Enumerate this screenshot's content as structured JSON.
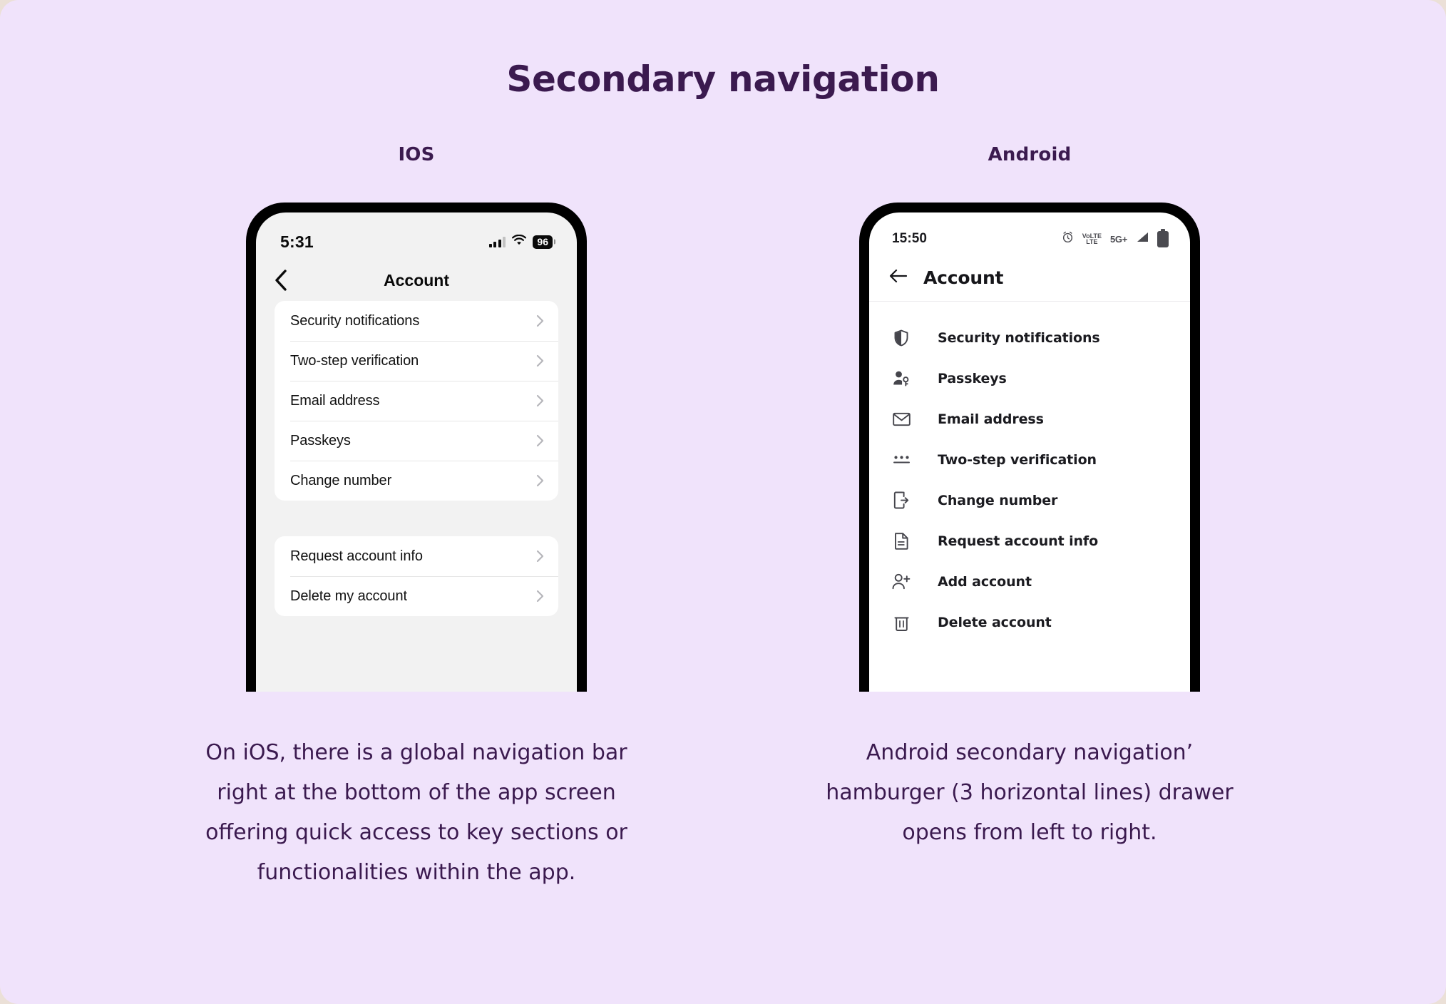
{
  "page": {
    "title": "Secondary navigation",
    "background_color": "#f0e3fb",
    "accent_color": "#3b1a4f",
    "outer_color": "#ebe0d7"
  },
  "ios": {
    "platform_label": "IOS",
    "status": {
      "time": "5:31",
      "battery_level": "96",
      "signal_icon": "cellular-signal-icon",
      "wifi_icon": "wifi-icon",
      "battery_icon": "battery-icon"
    },
    "nav": {
      "back_icon": "chevron-left-icon",
      "title": "Account"
    },
    "groups": [
      {
        "items": [
          {
            "label": "Security notifications",
            "chevron": "chevron-right-icon"
          },
          {
            "label": "Two-step verification",
            "chevron": "chevron-right-icon"
          },
          {
            "label": "Email address",
            "chevron": "chevron-right-icon"
          },
          {
            "label": "Passkeys",
            "chevron": "chevron-right-icon"
          },
          {
            "label": "Change number",
            "chevron": "chevron-right-icon"
          }
        ]
      },
      {
        "items": [
          {
            "label": "Request account info",
            "chevron": "chevron-right-icon"
          },
          {
            "label": "Delete my account",
            "chevron": "chevron-right-icon"
          }
        ]
      }
    ],
    "caption": "On iOS, there is a global navigation bar right at the bottom of the app screen offering quick access to key sections or functionalities within the app."
  },
  "android": {
    "platform_label": "Android",
    "status": {
      "time": "15:50",
      "alarm_icon": "alarm-clock-icon",
      "volte_line1": "VoLTE",
      "volte_line2": "LTE",
      "network": "5G+",
      "signal_icon": "signal-triangle-icon",
      "battery_icon": "battery-icon"
    },
    "appbar": {
      "back_icon": "arrow-left-icon",
      "title": "Account"
    },
    "items": [
      {
        "label": "Security notifications",
        "icon": "shield-icon"
      },
      {
        "label": "Passkeys",
        "icon": "person-key-icon"
      },
      {
        "label": "Email address",
        "icon": "envelope-icon"
      },
      {
        "label": "Two-step verification",
        "icon": "dots-passcode-icon"
      },
      {
        "label": "Change number",
        "icon": "phone-arrow-icon"
      },
      {
        "label": "Request account info",
        "icon": "document-icon"
      },
      {
        "label": "Add account",
        "icon": "person-plus-icon"
      },
      {
        "label": "Delete account",
        "icon": "trash-icon"
      }
    ],
    "caption": "Android secondary navigation’ hamburger (3 horizontal lines) drawer opens from left to right."
  }
}
